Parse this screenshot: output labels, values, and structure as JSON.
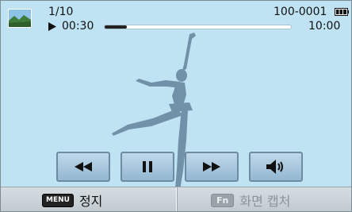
{
  "status": {
    "counter": "1/10",
    "elapsed": "00:30",
    "file_number": "100-0001",
    "total": "10:00",
    "progress_fraction": 0.12
  },
  "icons": {
    "thumbnail": "landscape-thumbnail-icon",
    "play": "play-icon",
    "battery": "battery-full-icon"
  },
  "controls": [
    {
      "name": "rewind-button",
      "icon": "rewind-icon"
    },
    {
      "name": "pause-button",
      "icon": "pause-icon"
    },
    {
      "name": "fast-forward-button",
      "icon": "fast-forward-icon"
    },
    {
      "name": "volume-button",
      "icon": "volume-icon"
    }
  ],
  "bottom": {
    "menu_key": "MENU",
    "menu_label": "정지",
    "fn_key": "Fn",
    "fn_label": "화면 캡처"
  },
  "colors": {
    "screen_bg": "#bfe3f3",
    "progress_fill": "#222222",
    "button_border": "#6d8ba2",
    "silhouette": "#6f8ea5"
  }
}
